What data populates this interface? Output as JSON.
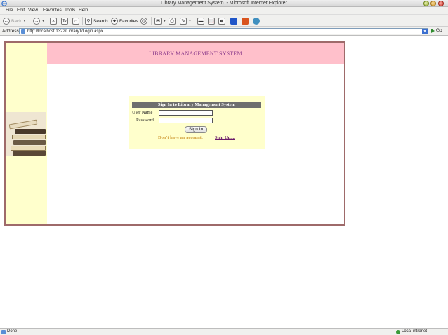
{
  "window": {
    "title": "Library Management System. - Microsoft Internet Explorer"
  },
  "menu": [
    "File",
    "Edit",
    "View",
    "Favorites",
    "Tools",
    "Help"
  ],
  "toolbar": {
    "back_label": "Back",
    "search_label": "Search",
    "favorites_label": "Favorites"
  },
  "address": {
    "label": "Address",
    "url": "http://localhost:1322/Library1/Login.aspx",
    "go_label": "Go"
  },
  "page": {
    "header_title": "LIBRARY MANAGEMENT SYSTEM",
    "login": {
      "heading": "Sign In to Library Management System",
      "username_label": "User Name",
      "password_label": "Password",
      "username_value": "",
      "password_value": "",
      "signin_label": "Sign In",
      "no_account_text": "Don't have an account:",
      "signup_label": "Sign Up...."
    }
  },
  "status": {
    "left_text": "Done",
    "zone_text": "Local intranet"
  },
  "colors": {
    "header_band": "#ffc0cb",
    "header_text": "#8b3a8b",
    "side_column": "#ffffcc",
    "login_box": "#ffffcc",
    "login_heading_bg": "#6e6e6e",
    "frame_border": "#9e6a6a",
    "no_account_text": "#d2a03c",
    "signup_link": "#6a1a6a"
  }
}
